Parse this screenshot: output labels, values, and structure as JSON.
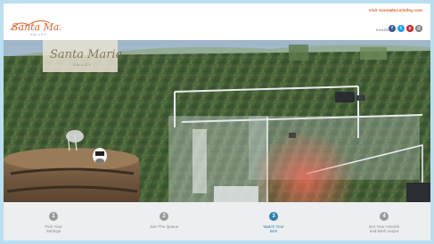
{
  "header": {
    "logo_text": "Santa Maria",
    "logo_sub": "VALLEY",
    "visit_link": "Visit SantaMariaValley.com",
    "share_label": "SHARE"
  },
  "social": [
    {
      "name": "facebook",
      "glyph": "f",
      "color": "#3b5998"
    },
    {
      "name": "twitter",
      "glyph": "t",
      "color": "#1da1f2"
    },
    {
      "name": "pinterest",
      "glyph": "p",
      "color": "#cb2027"
    },
    {
      "name": "email",
      "glyph": "@",
      "color": "#7a7a7a"
    }
  ],
  "hero": {
    "banner_text": "Santa Maria",
    "banner_sub": "VALLEY"
  },
  "steps": [
    {
      "number": "1",
      "label": "Pick Your\nSettings",
      "active": false
    },
    {
      "number": "2",
      "label": "Join The Queue",
      "active": false
    },
    {
      "number": "3",
      "label": "Watch Your\nBot!",
      "active": true
    },
    {
      "number": "4",
      "label": "Get Your Artwork\nand Both output",
      "active": false
    }
  ],
  "colors": {
    "accent": "#2b7fb3",
    "link": "#e0622b"
  }
}
